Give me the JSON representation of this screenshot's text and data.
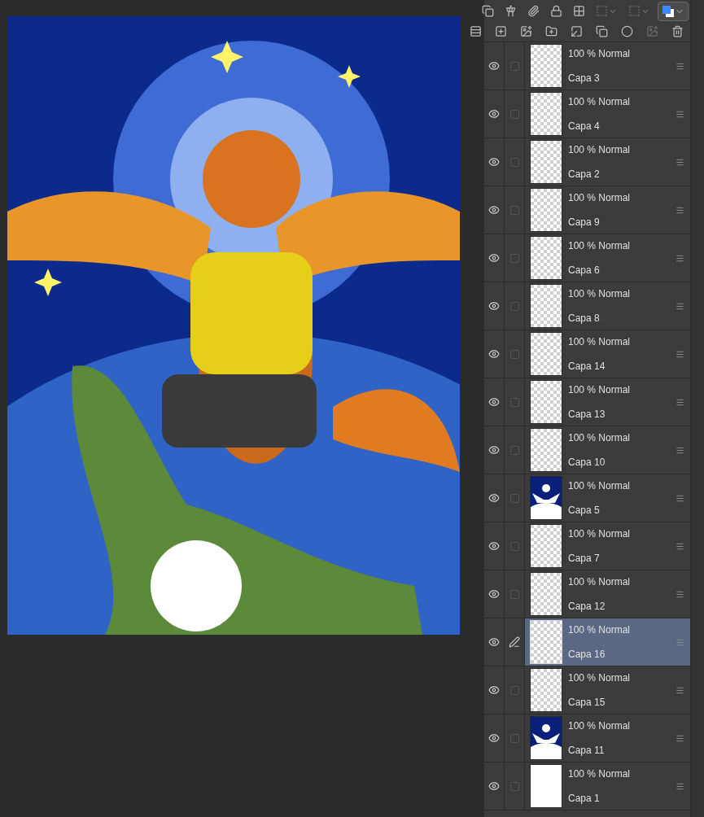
{
  "layers": [
    {
      "name": "Capa 3",
      "blend": "100 % Normal",
      "visible": true,
      "selected": false,
      "kind": "transparent"
    },
    {
      "name": "Capa 4",
      "blend": "100 % Normal",
      "visible": true,
      "selected": false,
      "kind": "transparent"
    },
    {
      "name": "Capa 2",
      "blend": "100 % Normal",
      "visible": true,
      "selected": false,
      "kind": "transparent"
    },
    {
      "name": "Capa 9",
      "blend": "100 % Normal",
      "visible": true,
      "selected": false,
      "kind": "transparent"
    },
    {
      "name": "Capa 6",
      "blend": "100 % Normal",
      "visible": true,
      "selected": false,
      "kind": "transparent"
    },
    {
      "name": "Capa 8",
      "blend": "100 % Normal",
      "visible": true,
      "selected": false,
      "kind": "transparent"
    },
    {
      "name": "Capa 14",
      "blend": "100 % Normal",
      "visible": true,
      "selected": false,
      "kind": "transparent"
    },
    {
      "name": "Capa 13",
      "blend": "100 % Normal",
      "visible": true,
      "selected": false,
      "kind": "transparent"
    },
    {
      "name": "Capa 10",
      "blend": "100 % Normal",
      "visible": true,
      "selected": false,
      "kind": "transparent"
    },
    {
      "name": "Capa 5",
      "blend": "100 % Normal",
      "visible": true,
      "selected": false,
      "kind": "art"
    },
    {
      "name": "Capa 7",
      "blend": "100 % Normal",
      "visible": true,
      "selected": false,
      "kind": "transparent"
    },
    {
      "name": "Capa 12",
      "blend": "100 % Normal",
      "visible": true,
      "selected": false,
      "kind": "transparent"
    },
    {
      "name": "Capa 16",
      "blend": "100 % Normal",
      "visible": true,
      "selected": true,
      "kind": "transparent"
    },
    {
      "name": "Capa 15",
      "blend": "100 % Normal",
      "visible": true,
      "selected": false,
      "kind": "transparent"
    },
    {
      "name": "Capa 11",
      "blend": "100 % Normal",
      "visible": true,
      "selected": false,
      "kind": "art"
    },
    {
      "name": "Capa 1",
      "blend": "100 % Normal",
      "visible": true,
      "selected": false,
      "kind": "white"
    }
  ]
}
